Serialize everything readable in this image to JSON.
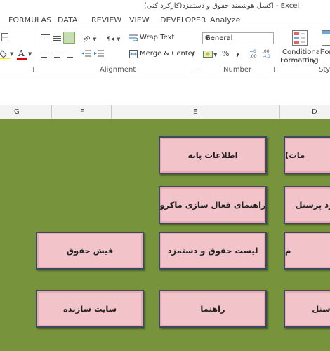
{
  "window": {
    "title": "اکسل هوشمند حقوق و دستمزد(کارکرد کنی) - Excel"
  },
  "tabs": [
    "FORMULAS",
    "DATA",
    "REVIEW",
    "VIEW",
    "DEVELOPER",
    "Analyze"
  ],
  "ribbon": {
    "alignment": {
      "label": "Alignment",
      "wrap_text": "Wrap Text",
      "merge_center": "Merge & Center"
    },
    "number": {
      "label": "Number",
      "format_value": "General",
      "percent_symbol": "%",
      "comma_symbol": ","
    },
    "styles": {
      "conditional": "Conditional",
      "formatting": "Formatting",
      "format_as_table_partial": "For",
      "group_partial": "Styl"
    }
  },
  "columns": [
    "G",
    "F",
    "E",
    "D"
  ],
  "buttons": {
    "base_info": "اطلاعات پایه",
    "general_info_partial": "مات)",
    "macro_guide": "راهنمای فعال سازی ماکرو",
    "personnel_work_partial": "کرد پرسنل",
    "payslip": "فیش حقوق",
    "payroll_list": "لیست حقوق و دستمزد",
    "partial_m": "م",
    "creator_site": "سایت سازنده",
    "guide": "راهنما",
    "personnel_partial": "پرسنل"
  },
  "colors": {
    "sheet_background": "#77933c",
    "button_fill": "#f2c3c8",
    "button_border": "#3b4a5e"
  }
}
